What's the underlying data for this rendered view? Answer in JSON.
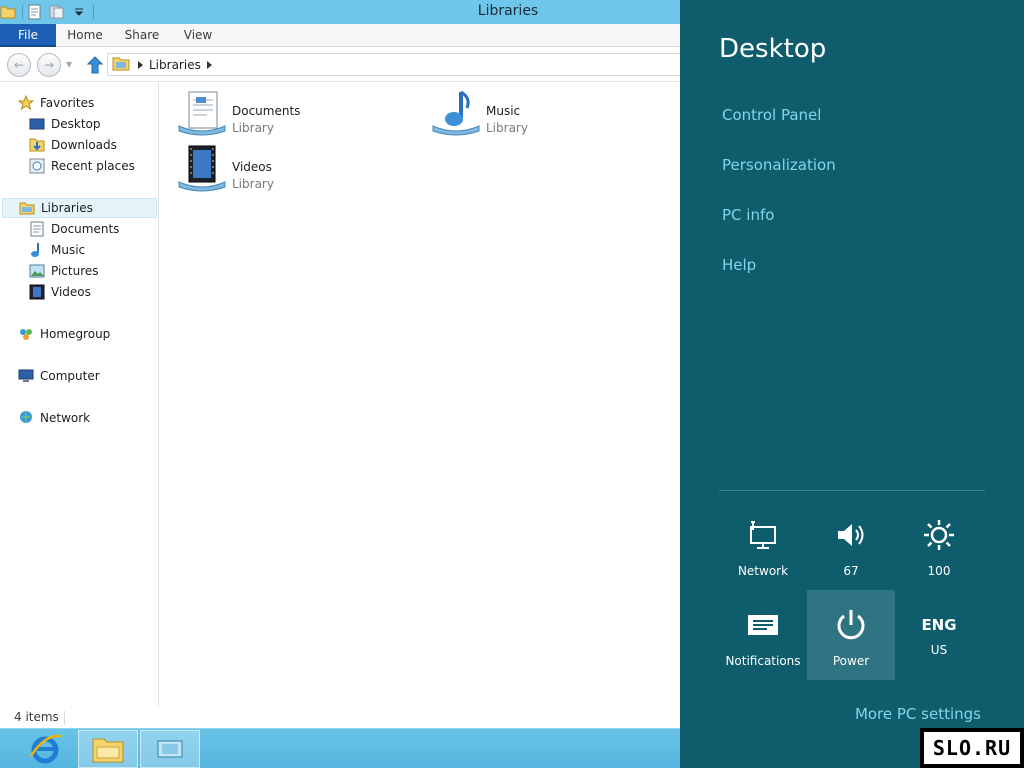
{
  "window": {
    "title": "Libraries"
  },
  "ribbon": {
    "tabs": [
      "File",
      "Home",
      "Share",
      "View"
    ]
  },
  "address": {
    "crumb": "Libraries"
  },
  "nav": {
    "favorites": "Favorites",
    "favorite_items": [
      "Desktop",
      "Downloads",
      "Recent places"
    ],
    "libraries": "Libraries",
    "library_items": [
      "Documents",
      "Music",
      "Pictures",
      "Videos"
    ],
    "homegroup": "Homegroup",
    "computer": "Computer",
    "network": "Network"
  },
  "content": {
    "libraries": [
      {
        "name": "Documents",
        "type": "Library"
      },
      {
        "name": "Music",
        "type": "Library"
      },
      {
        "name": "Videos",
        "type": "Library"
      }
    ]
  },
  "status": {
    "items": "4 items"
  },
  "charm": {
    "title": "Desktop",
    "links": [
      "Control Panel",
      "Personalization",
      "PC info",
      "Help"
    ],
    "tiles": [
      {
        "label": "Network",
        "icon": "network-icon"
      },
      {
        "label": "67",
        "icon": "volume-icon"
      },
      {
        "label": "100",
        "icon": "brightness-icon"
      },
      {
        "label": "Notifications",
        "icon": "notifications-icon"
      },
      {
        "label": "Power",
        "icon": "power-icon"
      },
      {
        "big": "ENG",
        "label": "US"
      }
    ],
    "more": "More PC settings"
  },
  "watermark": {
    "text": "SLO.RU"
  },
  "colors": {
    "charm_bg": "#0f5c6c",
    "charm_link": "#7fd8e6",
    "file_tab": "#1c5fb5",
    "taskbar": "#69c3e7"
  }
}
